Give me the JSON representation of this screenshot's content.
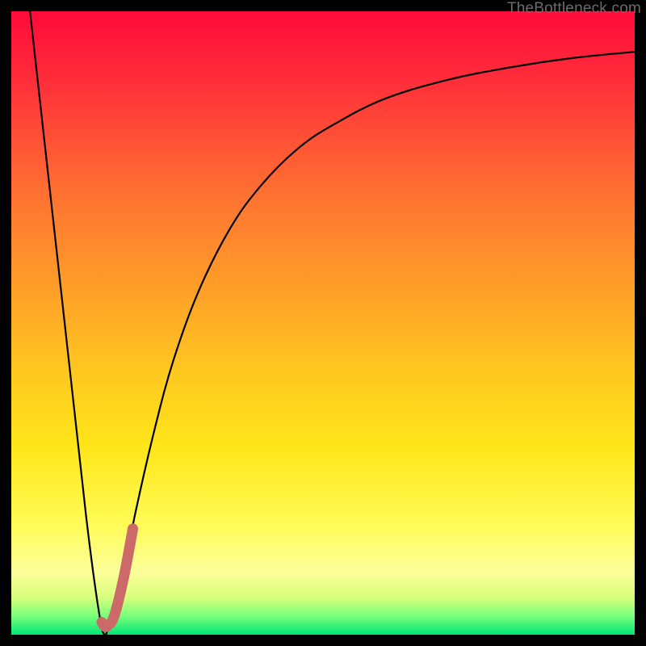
{
  "watermark": "TheBottleneck.com",
  "chart_data": {
    "type": "line",
    "title": "",
    "xlabel": "",
    "ylabel": "",
    "x_range": [
      0,
      100
    ],
    "y_range": [
      0,
      100
    ],
    "series": [
      {
        "name": "bottleneck-curve",
        "stroke": "#000000",
        "stroke_width": 2.2,
        "x": [
          3,
          6,
          9,
          12,
          14,
          15,
          16,
          18,
          20,
          23,
          26,
          30,
          35,
          40,
          46,
          52,
          60,
          70,
          80,
          90,
          100
        ],
        "y": [
          100,
          73,
          46,
          19,
          4,
          0,
          3,
          10,
          20,
          33,
          44,
          55,
          65,
          72,
          78,
          82,
          86,
          89,
          91,
          92.5,
          93.5
        ]
      },
      {
        "name": "highlight-segment",
        "stroke": "#cc6a6a",
        "stroke_width": 13,
        "linecap": "round",
        "x": [
          14.5,
          15.0,
          15.5,
          16.5,
          18.0,
          19.5
        ],
        "y": [
          2.0,
          1.3,
          1.5,
          3.0,
          9.0,
          17.0
        ]
      }
    ],
    "gradient_stops": [
      {
        "pct": 0,
        "color": "#ff0a3a"
      },
      {
        "pct": 50,
        "color": "#ffc81f"
      },
      {
        "pct": 95,
        "color": "#d8ff7c"
      },
      {
        "pct": 100,
        "color": "#00e676"
      }
    ]
  }
}
